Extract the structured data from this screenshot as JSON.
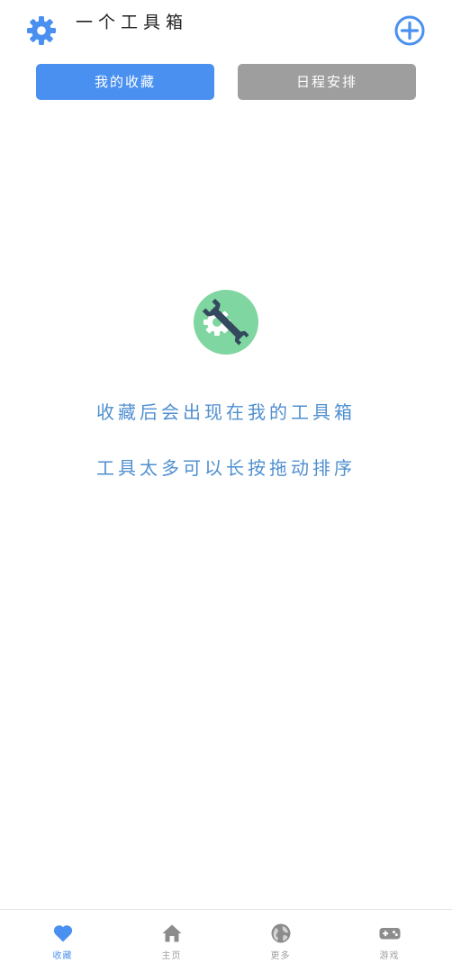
{
  "header": {
    "title": "一个工具箱",
    "settings_icon": "gear-icon",
    "add_icon": "plus-circle-icon"
  },
  "tabs": [
    {
      "label": "我的收藏",
      "active": true,
      "color": "#4a90f0"
    },
    {
      "label": "日程安排",
      "active": false,
      "color": "#9e9e9e"
    }
  ],
  "empty_state": {
    "icon": "wrench-gear-icon",
    "line1": "收藏后会出现在我的工具箱",
    "line2": "工具太多可以长按拖动排序",
    "text_color": "#4f8fd0"
  },
  "bottom_nav": [
    {
      "label": "收藏",
      "icon": "heart-icon",
      "active": true
    },
    {
      "label": "主页",
      "icon": "home-icon",
      "active": false
    },
    {
      "label": "更多",
      "icon": "globe-icon",
      "active": false
    },
    {
      "label": "游戏",
      "icon": "gamepad-icon",
      "active": false
    }
  ],
  "colors": {
    "accent": "#4a90f0",
    "inactive": "#9e9e9e",
    "icon_bg": "#7fd6a0",
    "icon_dark": "#34495e"
  }
}
